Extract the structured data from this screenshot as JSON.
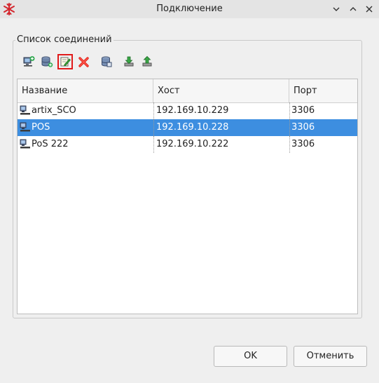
{
  "window": {
    "title": "Подключение",
    "icons": {
      "app": "snowflake-icon",
      "minimize": "chevron-down-icon",
      "maximize": "chevron-up-icon",
      "close": "close-icon"
    }
  },
  "group": {
    "title": "Список соединений"
  },
  "toolbar": {
    "buttons": [
      {
        "name": "add-connection",
        "icon": "add-network-icon"
      },
      {
        "name": "add-database",
        "icon": "add-database-icon"
      },
      {
        "name": "edit-connection",
        "icon": "edit-icon",
        "selected": true
      },
      {
        "name": "delete-connection",
        "icon": "delete-icon"
      },
      {
        "name": "copy-database",
        "icon": "database-icon"
      },
      {
        "name": "import",
        "icon": "import-icon"
      },
      {
        "name": "export",
        "icon": "export-icon"
      }
    ],
    "highlight_color": "#e01a1a"
  },
  "table": {
    "headers": {
      "name": "Название",
      "host": "Хост",
      "port": "Порт"
    },
    "rows": [
      {
        "name": "artix_SCO",
        "host": "192.169.10.229",
        "port": "3306",
        "selected": false
      },
      {
        "name": "POS",
        "host": "192.169.10.228",
        "port": "3306",
        "selected": true
      },
      {
        "name": "PoS 222",
        "host": "192.169.10.222",
        "port": "3306",
        "selected": false
      }
    ],
    "row_icon": "computer-icon",
    "selection_color": "#3d8ee0"
  },
  "buttons": {
    "ok": "OK",
    "cancel": "Отменить"
  }
}
